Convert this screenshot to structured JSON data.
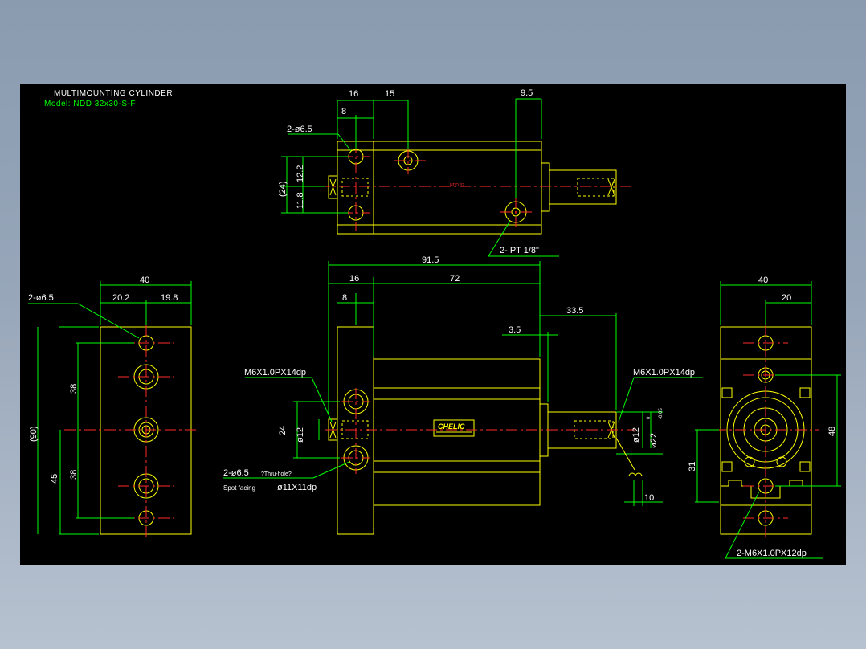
{
  "title": {
    "line1": "MULTIMOUNTING CYLINDER",
    "line2": "Model: NDD 32x30-S-F"
  },
  "top_view": {
    "dims": [
      "16",
      "15",
      "8",
      "9.5",
      "12.2",
      "11.8",
      "(24)"
    ],
    "notes": {
      "holes": "2-ø6.5",
      "ports": "2- PT 1/8\"",
      "body_mark": "NDD 32"
    }
  },
  "left_view": {
    "dims": [
      "40",
      "20.2",
      "19.8",
      "(90)",
      "38",
      "38",
      "45"
    ],
    "notes": {
      "holes": "2-ø6.5"
    }
  },
  "front_view": {
    "dims": [
      "91.5",
      "16",
      "72",
      "8",
      "33.5",
      "3.5",
      "24",
      "ø12",
      "ø12",
      "ø22",
      "10"
    ],
    "tolerance": {
      "upper": "0",
      "lower": "-0.05"
    },
    "notes": {
      "thread_left": "M6X1.0PX14dp",
      "thread_right": "M6X1.0PX14dp",
      "thru_hole": "2-ø6.5",
      "thru_hole_suffix": "?Thru-hole?",
      "spot_facing_label": "Spot facing",
      "spot_facing_value": "ø11X11dp"
    },
    "brand_label": "CHELIC"
  },
  "right_view": {
    "dims": [
      "40",
      "20",
      "48",
      "31"
    ],
    "notes": {
      "thread": "2-M6X1.0PX12dp"
    }
  },
  "colors": {
    "background": "#000000",
    "outline": "#ffff00",
    "dimension": "#00ff00",
    "centerline": "#ff2a2a",
    "text": "#ffffff"
  }
}
